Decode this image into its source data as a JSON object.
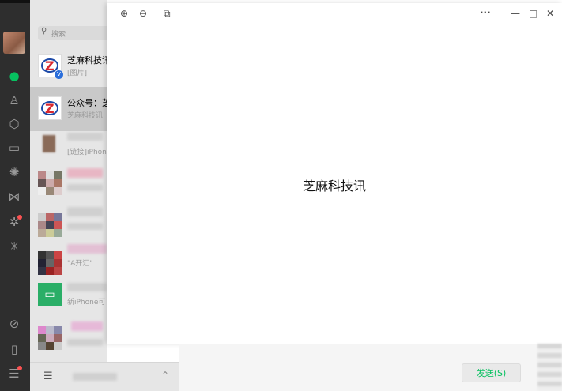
{
  "search": {
    "placeholder": "搜索"
  },
  "sidebar": {
    "icons": [
      "chat-icon",
      "contacts-icon",
      "box-icon",
      "folder-icon",
      "aperture-icon",
      "butterfly-icon",
      "gear-icon",
      "sparkle-icon",
      "compass-icon",
      "phone-icon",
      "menu-icon"
    ]
  },
  "chats": [
    {
      "title": "芝麻科技讯",
      "subtitle": "[图片]"
    },
    {
      "title": "公众号：芝",
      "subtitle": "芝麻科技讯"
    },
    {
      "title": "",
      "subtitle": "[链接]iPhone"
    },
    {
      "title": "",
      "subtitle": ""
    },
    {
      "title": "",
      "subtitle": ""
    },
    {
      "title": "",
      "subtitle": "\"A开汇\""
    },
    {
      "title": "",
      "subtitle": "新iPhone可"
    },
    {
      "title": "",
      "subtitle": ""
    }
  ],
  "viewer": {
    "center_text": "芝麻科技讯",
    "more": "···",
    "minimize": "—",
    "maximize": "□",
    "close": "✕"
  },
  "composer": {
    "send_label": "发送(S)"
  }
}
